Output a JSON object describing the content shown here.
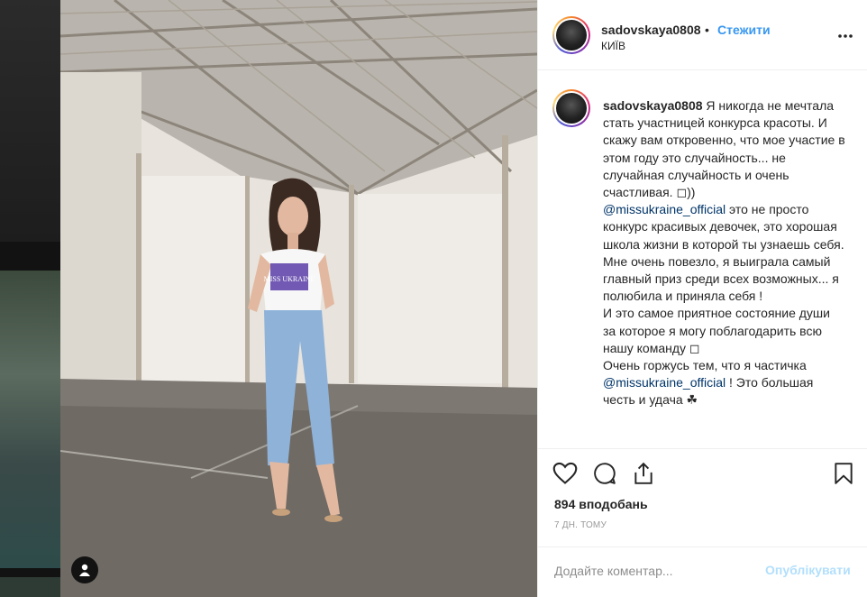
{
  "post": {
    "username": "sadovskaya0808",
    "separator": "•",
    "follow_label": "Стежити",
    "location": "КИЇВ",
    "more_icon": "more-horizontal-icon"
  },
  "caption": {
    "username": "sadovskaya0808",
    "text_1": " Я никогда не мечтала стать участницей конкурса красоты. И скажу вам откровенно, что мое участие в этом году это случайность... не случайная случайность и очень счастливая. ◻))\n",
    "mention_1": "@missukraine_official",
    "text_2": " это не просто конкурс красивых девочек, это хорошая школа жизни в которой ты узнаешь себя.\nМне очень повезло, я выиграла самый главный приз среди всех возможных... я полюбила и приняла себя !\nИ это самое приятное состояние души за которое я могу поблагодарить всю нашу команду ◻\nОчень горжусь тем, что я частичка ",
    "mention_2": "@missukraine_official",
    "text_3": " ! Это большая честь и удача ☘"
  },
  "actions": {
    "like_icon": "heart-icon",
    "comment_icon": "comment-icon",
    "share_icon": "share-icon",
    "save_icon": "bookmark-icon",
    "likes_label": "894 вподобань",
    "timestamp": "7 ДН. ТОМУ"
  },
  "comment": {
    "placeholder": "Додайте коментар...",
    "publish_label": "Опублікувати"
  },
  "photo": {
    "user_tag_icon": "user-icon",
    "tshirt_print": "MISS UKRAINE"
  }
}
